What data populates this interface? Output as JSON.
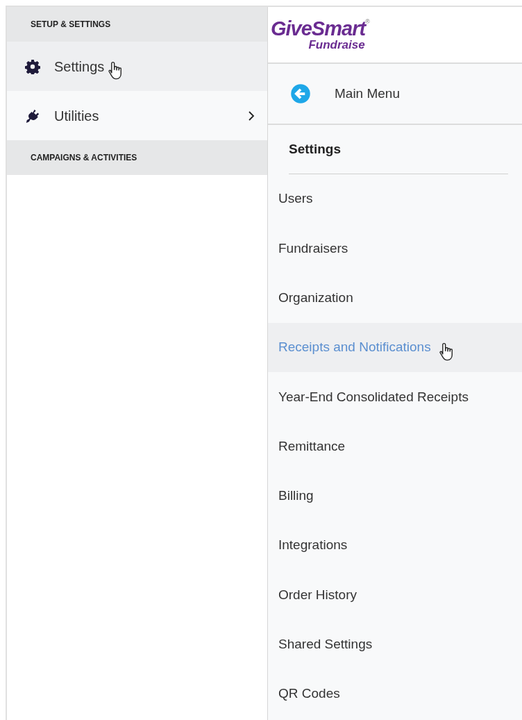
{
  "sidebar": {
    "sections": [
      {
        "heading": "SETUP & SETTINGS",
        "items": [
          {
            "label": "Settings",
            "kind": "gear",
            "hovered": true,
            "has_submenu": false
          },
          {
            "label": "Utilities",
            "kind": "plug",
            "hovered": false,
            "has_submenu": true
          }
        ]
      },
      {
        "heading": "CAMPAIGNS & ACTIVITIES"
      }
    ]
  },
  "logo": {
    "name": "GiveSmart",
    "mark": "®",
    "tagline": "Fundraise"
  },
  "submenu": {
    "back_label": "Main Menu",
    "heading": "Settings",
    "items": [
      {
        "label": "Users",
        "hovered": false
      },
      {
        "label": "Fundraisers",
        "hovered": false
      },
      {
        "label": "Organization",
        "hovered": false
      },
      {
        "label": "Receipts and Notifications",
        "hovered": true
      },
      {
        "label": "Year-End Consolidated Receipts",
        "hovered": false
      },
      {
        "label": "Remittance",
        "hovered": false
      },
      {
        "label": "Billing",
        "hovered": false
      },
      {
        "label": "Integrations",
        "hovered": false
      },
      {
        "label": "Order History",
        "hovered": false
      },
      {
        "label": "Shared Settings",
        "hovered": false
      },
      {
        "label": "QR Codes",
        "hovered": false
      }
    ]
  }
}
